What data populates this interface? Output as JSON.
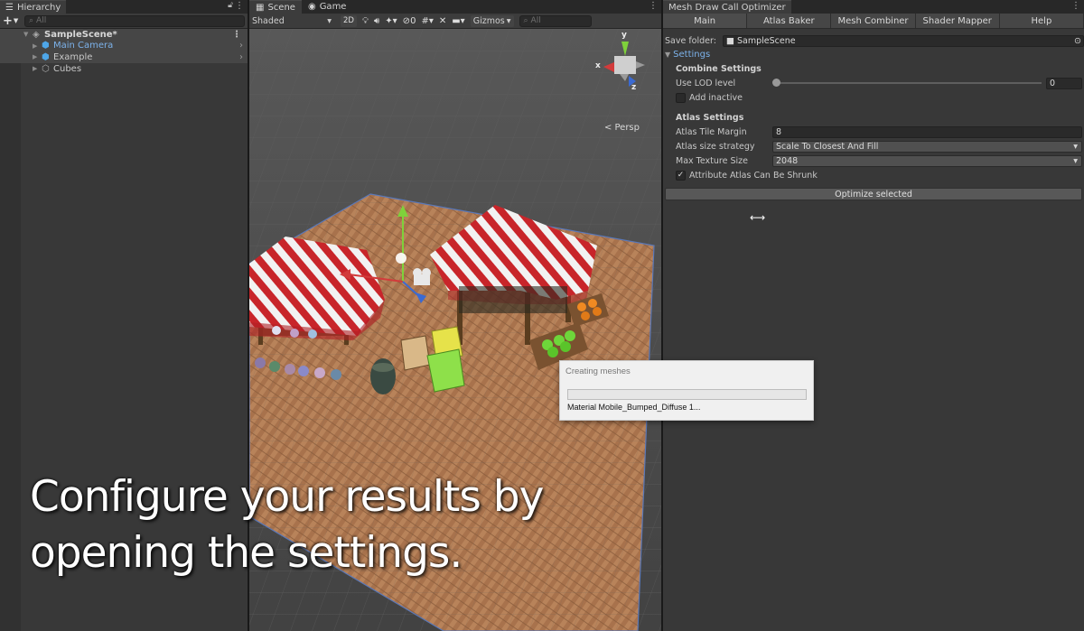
{
  "hierarchy": {
    "tab_label": "Hierarchy",
    "search_placeholder": "All",
    "scene": {
      "label": "SampleScene*"
    },
    "items": [
      {
        "label": "Main Camera"
      },
      {
        "label": "Example"
      },
      {
        "label": "Cubes"
      }
    ]
  },
  "scene_view": {
    "tabs": [
      {
        "label": "Scene"
      },
      {
        "label": "Game"
      }
    ],
    "shading_mode": "Shaded",
    "toggle_2d": "2D",
    "hidden_count": "0",
    "gizmos_label": "Gizmos",
    "search_placeholder": "All",
    "persp_label": "< Persp",
    "axes": {
      "x": "x",
      "y": "y",
      "z": "z"
    }
  },
  "progress_dialog": {
    "title": "Creating meshes",
    "info": "Material Mobile_Bumped_Diffuse 1...",
    "progress_fraction": 0.0
  },
  "optimizer": {
    "window_title": "Mesh Draw Call Optimizer",
    "tabs": [
      {
        "label": "Main"
      },
      {
        "label": "Atlas Baker"
      },
      {
        "label": "Mesh Combiner"
      },
      {
        "label": "Shader Mapper"
      },
      {
        "label": "Help"
      }
    ],
    "save_folder_label": "Save folder:",
    "save_folder_value": "SampleScene",
    "settings_foldout": "Settings",
    "combine_settings_title": "Combine Settings",
    "use_lod_label": "Use LOD level",
    "use_lod_value": "0",
    "add_inactive_label": "Add inactive",
    "add_inactive_checked": false,
    "atlas_settings_title": "Atlas Settings",
    "tile_margin_label": "Atlas Tile Margin",
    "tile_margin_value": "8",
    "size_strategy_label": "Atlas size strategy",
    "size_strategy_value": "Scale To Closest And Fill",
    "max_texture_label": "Max Texture Size",
    "max_texture_value": "2048",
    "shrink_label": "Attribute Atlas Can Be Shrunk",
    "shrink_checked": true,
    "optimize_button": "Optimize selected"
  },
  "caption": {
    "line1": "Configure your results by",
    "line2": "opening the settings."
  },
  "colors": {
    "unity_panel": "#383838",
    "selection_blue": "#7cb2ea",
    "progress_green": "#06b025",
    "axis_x": "#d23b3b",
    "axis_y": "#7fd13b",
    "axis_z": "#3b6ad2"
  }
}
